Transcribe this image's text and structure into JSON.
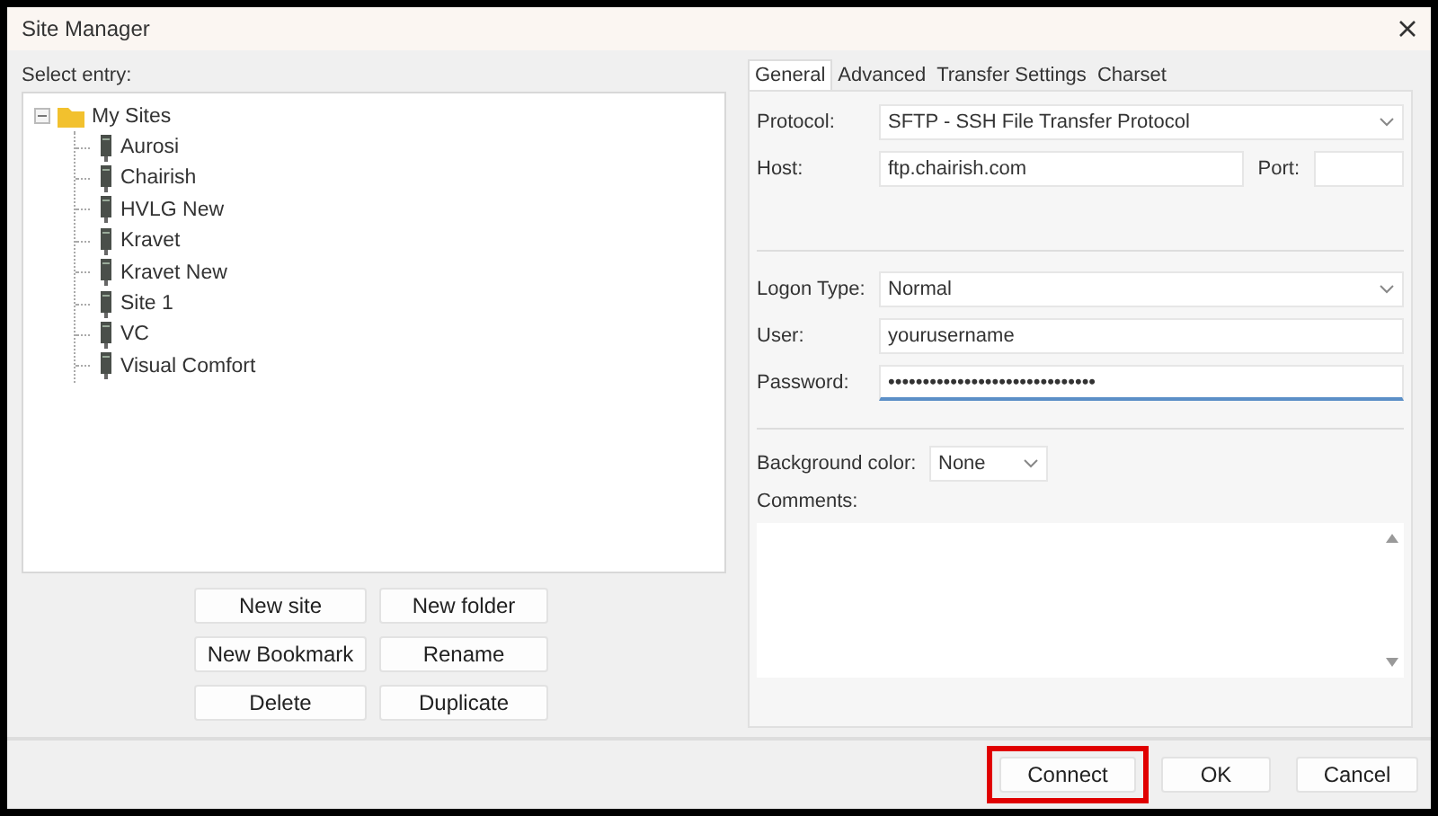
{
  "window": {
    "title": "Site Manager"
  },
  "select_entry_label": "Select entry:",
  "tree": [
    {
      "label": "My Sites",
      "kind": "folder",
      "expanded": true,
      "children": [
        {
          "label": "Aurosi",
          "kind": "site"
        },
        {
          "label": "Chairish",
          "kind": "site"
        },
        {
          "label": "HVLG New",
          "kind": "site"
        },
        {
          "label": "Kravet",
          "kind": "site"
        },
        {
          "label": "Kravet New",
          "kind": "site"
        },
        {
          "label": "Site 1",
          "kind": "site"
        },
        {
          "label": "VC",
          "kind": "site"
        },
        {
          "label": "Visual Comfort",
          "kind": "site"
        }
      ]
    }
  ],
  "tree_buttons": [
    "New site",
    "New folder",
    "New Bookmark",
    "Rename",
    "Delete",
    "Duplicate"
  ],
  "tabs": [
    {
      "label": "General",
      "selected": true
    },
    {
      "label": "Advanced",
      "selected": false
    },
    {
      "label": "Transfer Settings",
      "selected": false
    },
    {
      "label": "Charset",
      "selected": false
    }
  ],
  "protocol": {
    "label": "Protocol:",
    "value": "SFTP - SSH File Transfer Protocol"
  },
  "host": {
    "label": "Host:",
    "value": "ftp.chairish.com"
  },
  "port": {
    "label": "Port:"
  },
  "logon_type": {
    "label": "Logon Type:",
    "value": "Normal"
  },
  "user": {
    "label": "User:",
    "value": "yourusername"
  },
  "password": {
    "label": "Password:",
    "value": "••••••••••••••••••••••••••••••",
    "focused": true
  },
  "background_color": {
    "label": "Background color:",
    "value": "None"
  },
  "comments": {
    "label": "Comments:"
  },
  "buttons": [
    {
      "label": "Connect",
      "highlighted": true
    },
    {
      "label": "OK",
      "highlighted": false
    },
    {
      "label": "Cancel",
      "highlighted": false
    }
  ]
}
